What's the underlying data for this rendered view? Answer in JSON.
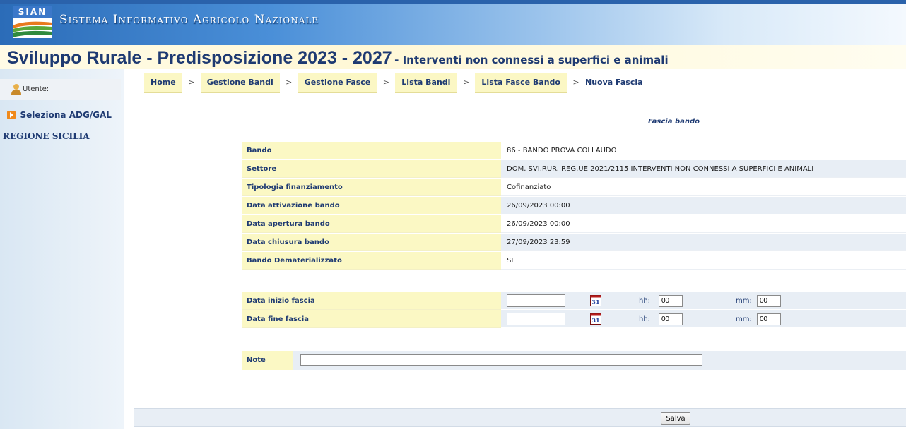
{
  "header": {
    "logo_text": "SIAN",
    "system_name": "Sistema Informativo Agricolo Nazionale",
    "title_main": "Sviluppo Rurale - Predisposizione 2023 - 2027",
    "title_sub": "- Interventi non connessi a superfici e animali"
  },
  "sidebar": {
    "user_label": "Utente:",
    "select_label": "Seleziona ADG/GAL",
    "region": "REGIONE SICILIA"
  },
  "breadcrumb": {
    "items": [
      "Home",
      "Gestione Bandi",
      "Gestione Fasce",
      "Lista Bandi",
      "Lista Fasce Bando"
    ],
    "separator": ">",
    "current": "Nuova Fascia"
  },
  "form": {
    "title": "Fascia bando",
    "info_rows": [
      {
        "label": "Bando",
        "value": "86 - BANDO PROVA COLLAUDO"
      },
      {
        "label": "Settore",
        "value": "DOM. SVI.RUR. REG.UE 2021/2115 INTERVENTI NON CONNESSI A SUPERFICI E ANIMALI"
      },
      {
        "label": "Tipologia finanziamento",
        "value": "Cofinanziato"
      },
      {
        "label": "Data attivazione bando",
        "value": "26/09/2023 00:00"
      },
      {
        "label": "Data apertura bando",
        "value": "26/09/2023 00:00"
      },
      {
        "label": "Data chiusura bando",
        "value": "27/09/2023 23:59"
      },
      {
        "label": "Bando Dematerializzato",
        "value": "SI"
      }
    ],
    "fascia_rows": [
      {
        "label": "Data inizio fascia",
        "date_value": "",
        "calendar_text": "31",
        "hh_label": "hh:",
        "hh_value": "00",
        "mm_label": "mm:",
        "mm_value": "00"
      },
      {
        "label": "Data fine fascia",
        "date_value": "",
        "calendar_text": "31",
        "hh_label": "hh:",
        "hh_value": "00",
        "mm_label": "mm:",
        "mm_value": "00"
      }
    ],
    "note_label": "Note",
    "note_value": ""
  },
  "footer": {
    "save_label": "Salva"
  },
  "icons": {
    "logo": "sian-logo-icon",
    "user": "user-icon",
    "select": "arrow-right-icon",
    "calendar": "calendar-icon"
  },
  "colors": {
    "header_blue": "#2b6cb8",
    "title_navy": "#1e3a72",
    "label_yellow": "#fbf8c4",
    "value_blue": "#e8eef5",
    "sidebar_blue": "#d9e7f3",
    "accent_orange": "#f08a1c"
  }
}
